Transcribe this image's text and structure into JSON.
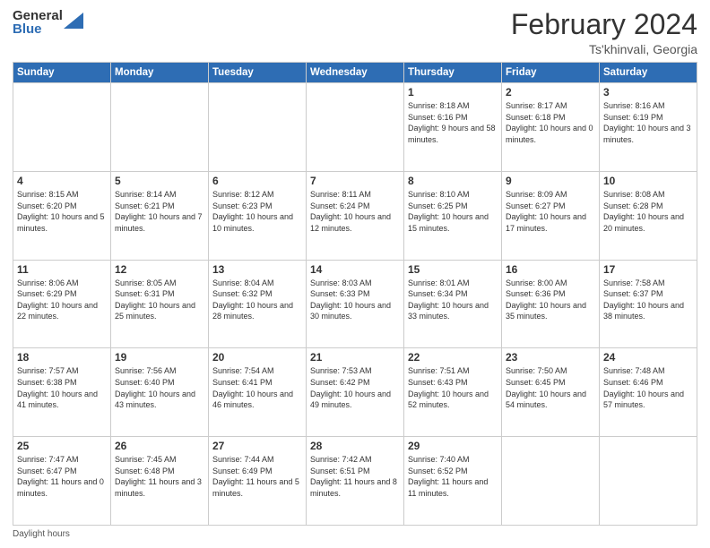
{
  "header": {
    "logo_general": "General",
    "logo_blue": "Blue",
    "main_title": "February 2024",
    "sub_title": "Ts'khinvali, Georgia"
  },
  "weekdays": [
    "Sunday",
    "Monday",
    "Tuesday",
    "Wednesday",
    "Thursday",
    "Friday",
    "Saturday"
  ],
  "weeks": [
    [
      {
        "day": "",
        "info": ""
      },
      {
        "day": "",
        "info": ""
      },
      {
        "day": "",
        "info": ""
      },
      {
        "day": "",
        "info": ""
      },
      {
        "day": "1",
        "info": "Sunrise: 8:18 AM\nSunset: 6:16 PM\nDaylight: 9 hours\nand 58 minutes."
      },
      {
        "day": "2",
        "info": "Sunrise: 8:17 AM\nSunset: 6:18 PM\nDaylight: 10 hours\nand 0 minutes."
      },
      {
        "day": "3",
        "info": "Sunrise: 8:16 AM\nSunset: 6:19 PM\nDaylight: 10 hours\nand 3 minutes."
      }
    ],
    [
      {
        "day": "4",
        "info": "Sunrise: 8:15 AM\nSunset: 6:20 PM\nDaylight: 10 hours\nand 5 minutes."
      },
      {
        "day": "5",
        "info": "Sunrise: 8:14 AM\nSunset: 6:21 PM\nDaylight: 10 hours\nand 7 minutes."
      },
      {
        "day": "6",
        "info": "Sunrise: 8:12 AM\nSunset: 6:23 PM\nDaylight: 10 hours\nand 10 minutes."
      },
      {
        "day": "7",
        "info": "Sunrise: 8:11 AM\nSunset: 6:24 PM\nDaylight: 10 hours\nand 12 minutes."
      },
      {
        "day": "8",
        "info": "Sunrise: 8:10 AM\nSunset: 6:25 PM\nDaylight: 10 hours\nand 15 minutes."
      },
      {
        "day": "9",
        "info": "Sunrise: 8:09 AM\nSunset: 6:27 PM\nDaylight: 10 hours\nand 17 minutes."
      },
      {
        "day": "10",
        "info": "Sunrise: 8:08 AM\nSunset: 6:28 PM\nDaylight: 10 hours\nand 20 minutes."
      }
    ],
    [
      {
        "day": "11",
        "info": "Sunrise: 8:06 AM\nSunset: 6:29 PM\nDaylight: 10 hours\nand 22 minutes."
      },
      {
        "day": "12",
        "info": "Sunrise: 8:05 AM\nSunset: 6:31 PM\nDaylight: 10 hours\nand 25 minutes."
      },
      {
        "day": "13",
        "info": "Sunrise: 8:04 AM\nSunset: 6:32 PM\nDaylight: 10 hours\nand 28 minutes."
      },
      {
        "day": "14",
        "info": "Sunrise: 8:03 AM\nSunset: 6:33 PM\nDaylight: 10 hours\nand 30 minutes."
      },
      {
        "day": "15",
        "info": "Sunrise: 8:01 AM\nSunset: 6:34 PM\nDaylight: 10 hours\nand 33 minutes."
      },
      {
        "day": "16",
        "info": "Sunrise: 8:00 AM\nSunset: 6:36 PM\nDaylight: 10 hours\nand 35 minutes."
      },
      {
        "day": "17",
        "info": "Sunrise: 7:58 AM\nSunset: 6:37 PM\nDaylight: 10 hours\nand 38 minutes."
      }
    ],
    [
      {
        "day": "18",
        "info": "Sunrise: 7:57 AM\nSunset: 6:38 PM\nDaylight: 10 hours\nand 41 minutes."
      },
      {
        "day": "19",
        "info": "Sunrise: 7:56 AM\nSunset: 6:40 PM\nDaylight: 10 hours\nand 43 minutes."
      },
      {
        "day": "20",
        "info": "Sunrise: 7:54 AM\nSunset: 6:41 PM\nDaylight: 10 hours\nand 46 minutes."
      },
      {
        "day": "21",
        "info": "Sunrise: 7:53 AM\nSunset: 6:42 PM\nDaylight: 10 hours\nand 49 minutes."
      },
      {
        "day": "22",
        "info": "Sunrise: 7:51 AM\nSunset: 6:43 PM\nDaylight: 10 hours\nand 52 minutes."
      },
      {
        "day": "23",
        "info": "Sunrise: 7:50 AM\nSunset: 6:45 PM\nDaylight: 10 hours\nand 54 minutes."
      },
      {
        "day": "24",
        "info": "Sunrise: 7:48 AM\nSunset: 6:46 PM\nDaylight: 10 hours\nand 57 minutes."
      }
    ],
    [
      {
        "day": "25",
        "info": "Sunrise: 7:47 AM\nSunset: 6:47 PM\nDaylight: 11 hours\nand 0 minutes."
      },
      {
        "day": "26",
        "info": "Sunrise: 7:45 AM\nSunset: 6:48 PM\nDaylight: 11 hours\nand 3 minutes."
      },
      {
        "day": "27",
        "info": "Sunrise: 7:44 AM\nSunset: 6:49 PM\nDaylight: 11 hours\nand 5 minutes."
      },
      {
        "day": "28",
        "info": "Sunrise: 7:42 AM\nSunset: 6:51 PM\nDaylight: 11 hours\nand 8 minutes."
      },
      {
        "day": "29",
        "info": "Sunrise: 7:40 AM\nSunset: 6:52 PM\nDaylight: 11 hours\nand 11 minutes."
      },
      {
        "day": "",
        "info": ""
      },
      {
        "day": "",
        "info": ""
      }
    ]
  ],
  "footer": {
    "daylight_label": "Daylight hours"
  }
}
